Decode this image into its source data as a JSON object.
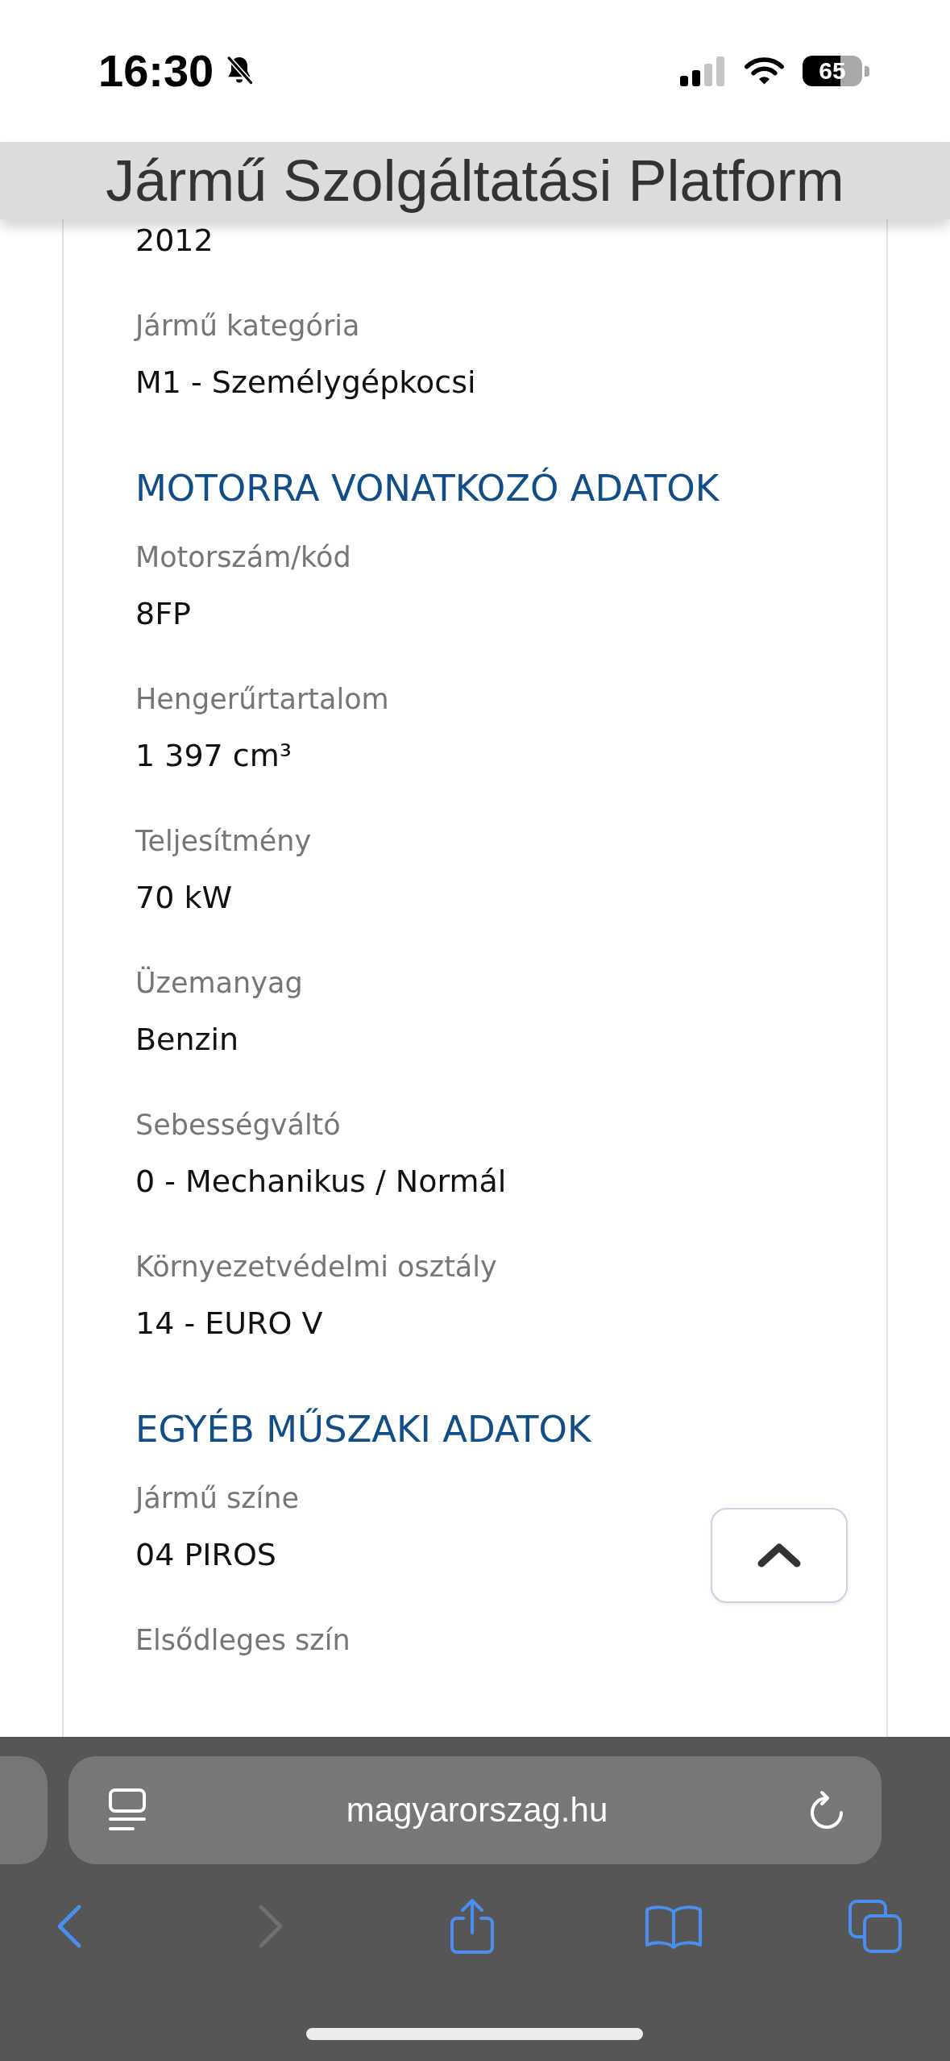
{
  "status_bar": {
    "time": "16:30",
    "battery": "65"
  },
  "header": {
    "title": "Jármű Szolgáltatási Platform"
  },
  "sections": [
    {
      "rows": [
        {
          "value": "2012"
        },
        {
          "label": "Jármű kategória",
          "value": "M1 - Személygépkocsi"
        }
      ]
    },
    {
      "heading": "MOTORRA VONATKOZÓ ADATOK",
      "rows": [
        {
          "label": "Motorszám/kód",
          "value": "8FP"
        },
        {
          "label": "Hengerűrtartalom",
          "value": "1 397 cm³"
        },
        {
          "label": "Teljesítmény",
          "value": "70 kW"
        },
        {
          "label": "Üzemanyag",
          "value": "Benzin"
        },
        {
          "label": "Sebességváltó",
          "value": "0 - Mechanikus / Normál"
        },
        {
          "label": "Környezetvédelmi osztály",
          "value": "14 - EURO V"
        }
      ]
    },
    {
      "heading": "EGYÉB MŰSZAKI ADATOK",
      "rows": [
        {
          "label": "Jármű színe",
          "value": "04 PIROS"
        },
        {
          "label": "Elsődleges szín"
        }
      ]
    }
  ],
  "browser": {
    "url": "magyarorszag.hu",
    "back": {
      "disabled": false
    },
    "forward": {
      "disabled": true
    }
  }
}
